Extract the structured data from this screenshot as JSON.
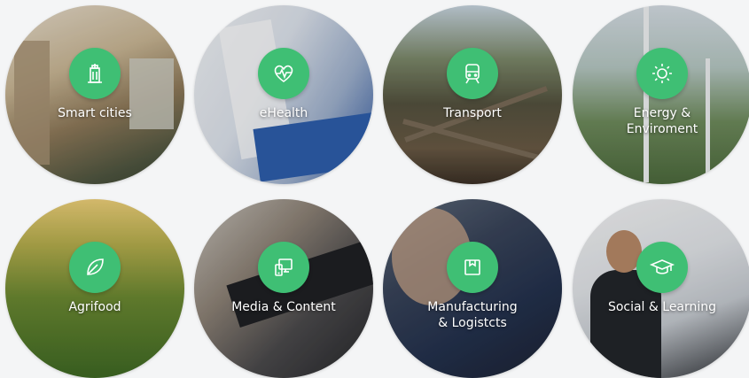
{
  "accent_color": "#3fbf74",
  "tiles": [
    {
      "label": "Smart cities",
      "icon": "building-icon"
    },
    {
      "label": "eHealth",
      "icon": "heartbeat-icon"
    },
    {
      "label": "Transport",
      "icon": "train-icon"
    },
    {
      "label": "Energy &\nEnviroment",
      "icon": "sun-icon"
    },
    {
      "label": "Agrifood",
      "icon": "leaf-icon"
    },
    {
      "label": "Media & Content",
      "icon": "devices-icon"
    },
    {
      "label": "Manufacturing\n& Logistcts",
      "icon": "box-icon"
    },
    {
      "label": "Social & Learning",
      "icon": "graduation-cap-icon"
    }
  ]
}
